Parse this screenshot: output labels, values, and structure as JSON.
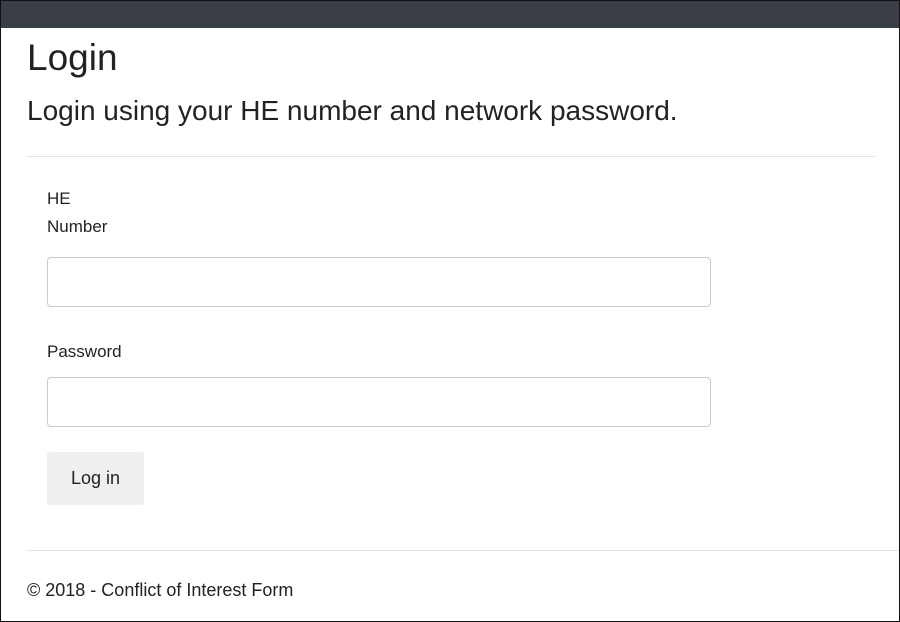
{
  "page": {
    "title": "Login",
    "subtitle": "Login using your HE number and network password."
  },
  "form": {
    "he_label": "HE\nNumber",
    "he_value": "",
    "password_label": "Password",
    "password_value": "",
    "submit_label": "Log in"
  },
  "footer": {
    "text": "© 2018 - Conflict of Interest Form"
  },
  "colors": {
    "navbar": "#3a3f47",
    "button_bg": "#efefef",
    "input_border": "#cccccc",
    "divider": "#e3e3e3"
  }
}
